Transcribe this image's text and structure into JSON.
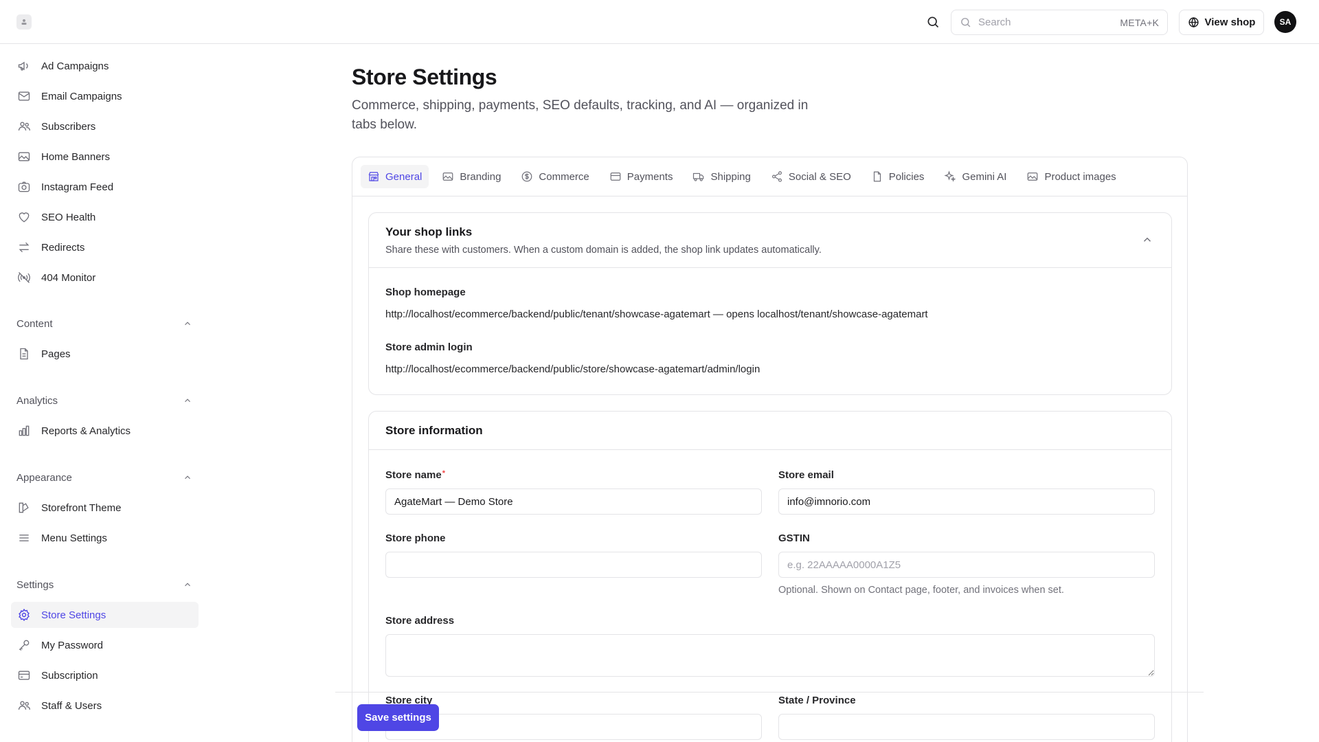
{
  "topbar": {
    "search_placeholder": "Search",
    "search_shortcut": "META+K",
    "view_shop_label": "View shop",
    "avatar_initials": "SA"
  },
  "sidebar": {
    "items_top": [
      {
        "label": "Ad Campaigns",
        "icon": "megaphone-icon"
      },
      {
        "label": "Email Campaigns",
        "icon": "mail-icon"
      },
      {
        "label": "Subscribers",
        "icon": "users-icon"
      },
      {
        "label": "Home Banners",
        "icon": "image-icon"
      },
      {
        "label": "Instagram Feed",
        "icon": "camera-icon"
      },
      {
        "label": "SEO Health",
        "icon": "heart-icon"
      },
      {
        "label": "Redirects",
        "icon": "arrows-icon"
      },
      {
        "label": "404 Monitor",
        "icon": "signal-icon"
      }
    ],
    "content": {
      "title": "Content",
      "items": [
        {
          "label": "Pages",
          "icon": "page-icon"
        }
      ]
    },
    "analytics": {
      "title": "Analytics",
      "items": [
        {
          "label": "Reports & Analytics",
          "icon": "bar-chart-icon"
        }
      ]
    },
    "appearance": {
      "title": "Appearance",
      "items": [
        {
          "label": "Storefront Theme",
          "icon": "brush-icon"
        },
        {
          "label": "Menu Settings",
          "icon": "menu-icon"
        }
      ]
    },
    "settings": {
      "title": "Settings",
      "items": [
        {
          "label": "Store Settings",
          "icon": "gear-icon"
        },
        {
          "label": "My Password",
          "icon": "key-icon"
        },
        {
          "label": "Subscription",
          "icon": "card-icon"
        },
        {
          "label": "Staff & Users",
          "icon": "users-icon"
        }
      ]
    }
  },
  "page": {
    "title": "Store Settings",
    "subtitle": "Commerce, shipping, payments, SEO defaults, tracking, and AI — organized in tabs below."
  },
  "tabs": [
    {
      "label": "General",
      "active": true
    },
    {
      "label": "Branding"
    },
    {
      "label": "Commerce"
    },
    {
      "label": "Payments"
    },
    {
      "label": "Shipping"
    },
    {
      "label": "Social & SEO"
    },
    {
      "label": "Policies"
    },
    {
      "label": "Gemini AI"
    },
    {
      "label": "Product images"
    }
  ],
  "links_panel": {
    "title": "Your shop links",
    "description": "Share these with customers. When a custom domain is added, the shop link updates automatically.",
    "homepage_label": "Shop homepage",
    "homepage_value": "http://localhost/ecommerce/backend/public/tenant/showcase-agatemart — opens localhost/tenant/showcase-agatemart",
    "admin_label": "Store admin login",
    "admin_value": "http://localhost/ecommerce/backend/public/store/showcase-agatemart/admin/login"
  },
  "info_panel": {
    "title": "Store information",
    "store_name_label": "Store name",
    "store_name_required": "*",
    "store_name_value": "AgateMart — Demo Store",
    "store_email_label": "Store email",
    "store_email_value": "info@imnorio.com",
    "store_phone_label": "Store phone",
    "store_phone_value": "",
    "gstin_label": "GSTIN",
    "gstin_placeholder": "e.g. 22AAAAA0000A1Z5",
    "gstin_hint": "Optional. Shown on Contact page, footer, and invoices when set.",
    "address_label": "Store address",
    "address_value": "",
    "city_label": "Store city",
    "state_label": "State / Province"
  },
  "save_label": "Save settings",
  "colors": {
    "accent": "#4f46e5",
    "border": "#e4e4e7",
    "muted": "#52525b"
  }
}
